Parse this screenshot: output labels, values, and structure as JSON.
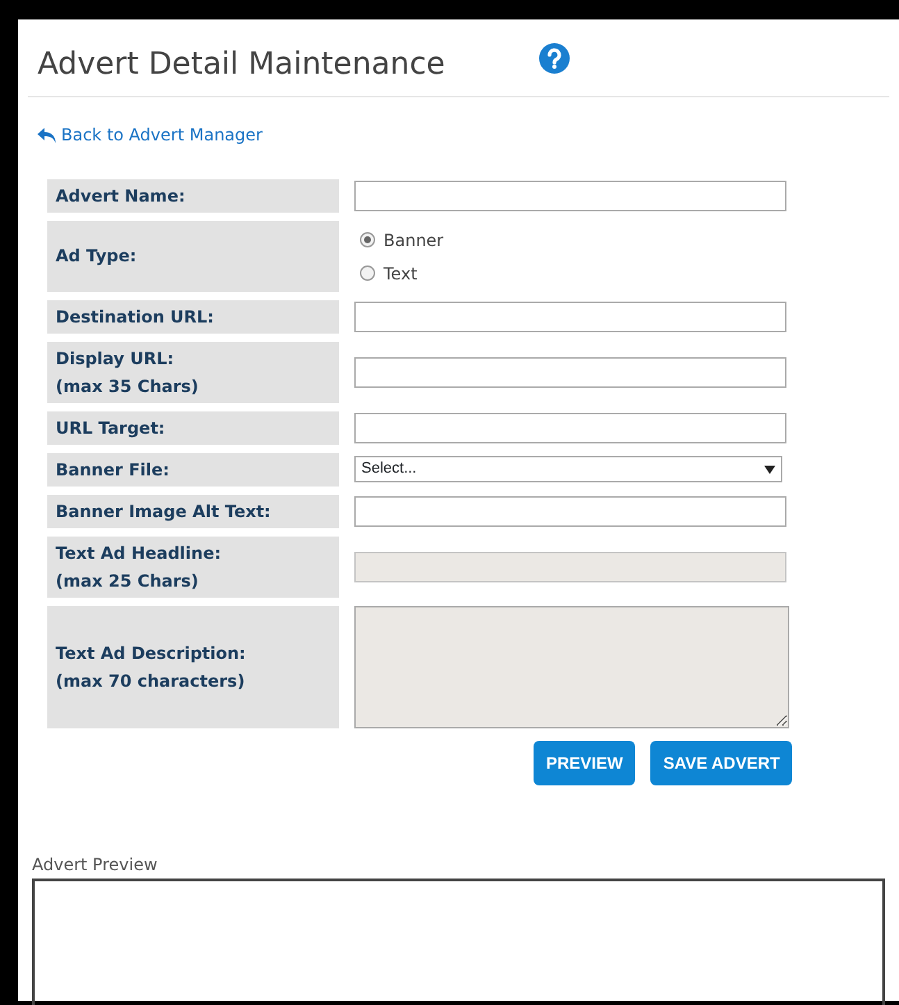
{
  "title": "Advert Detail Maintenance",
  "back_link": "Back to Advert Manager",
  "fields": [
    {
      "kind": "text",
      "label": "Advert Name:",
      "disabled": false
    },
    {
      "kind": "radio",
      "label": "Ad Type:",
      "options": [
        {
          "label": "Banner",
          "selected": true
        },
        {
          "label": "Text",
          "selected": false
        }
      ]
    },
    {
      "kind": "text",
      "label": "Destination URL:",
      "disabled": false
    },
    {
      "kind": "text",
      "label": "Display URL:",
      "note": "(max 35 Chars)",
      "disabled": false
    },
    {
      "kind": "text",
      "label": "URL Target:",
      "disabled": false
    },
    {
      "kind": "select",
      "label": "Banner File:",
      "value": "Select..."
    },
    {
      "kind": "text",
      "label": "Banner Image Alt Text:",
      "disabled": false
    },
    {
      "kind": "text",
      "label": "Text Ad Headline:",
      "note": "(max 25 Chars)",
      "disabled": true
    },
    {
      "kind": "textarea",
      "label": "Text Ad Description:",
      "note": "(max 70 characters)",
      "disabled": true
    }
  ],
  "buttons": [
    "PREVIEW",
    "SAVE ADVERT"
  ],
  "preview": {
    "label": "Advert Preview"
  }
}
